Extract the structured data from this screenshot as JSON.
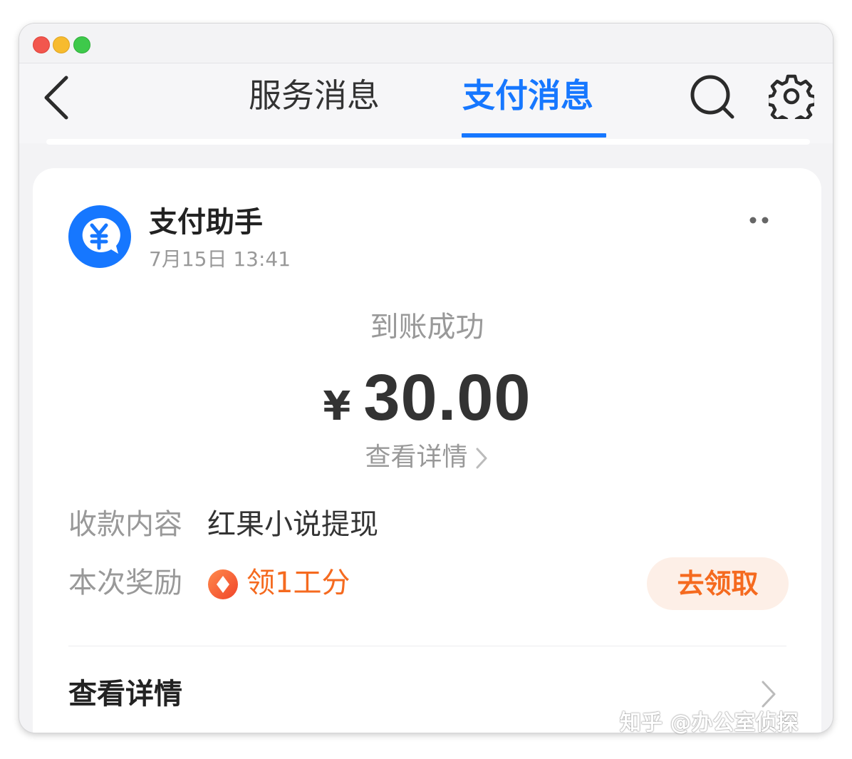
{
  "nav": {
    "tabs": [
      {
        "label": "服务消息",
        "active": false
      },
      {
        "label": "支付消息",
        "active": true
      }
    ]
  },
  "message": {
    "sender": "支付助手",
    "time": "7月15日 13:41",
    "status": "到账成功",
    "currency": "¥",
    "amount": "30.00",
    "detail_link": "查看详情",
    "rows": [
      {
        "label": "收款内容",
        "value": "红果小说提现"
      },
      {
        "label": "本次奖励",
        "value": "领1工分"
      }
    ],
    "claim_button": "去领取",
    "footer_link": "查看详情"
  },
  "icons": {
    "back": "chevron-left-icon",
    "search": "search-icon",
    "settings": "gear-icon",
    "avatar": "yuan-chat-bubble-icon",
    "more": "more-dots-icon",
    "reward": "reward-coin-icon"
  },
  "colors": {
    "accent": "#1677ff",
    "reward": "#f56a1f",
    "claim_bg": "#fdefe7",
    "muted_text": "#999999"
  },
  "watermark": "知乎 @办公室侦探"
}
